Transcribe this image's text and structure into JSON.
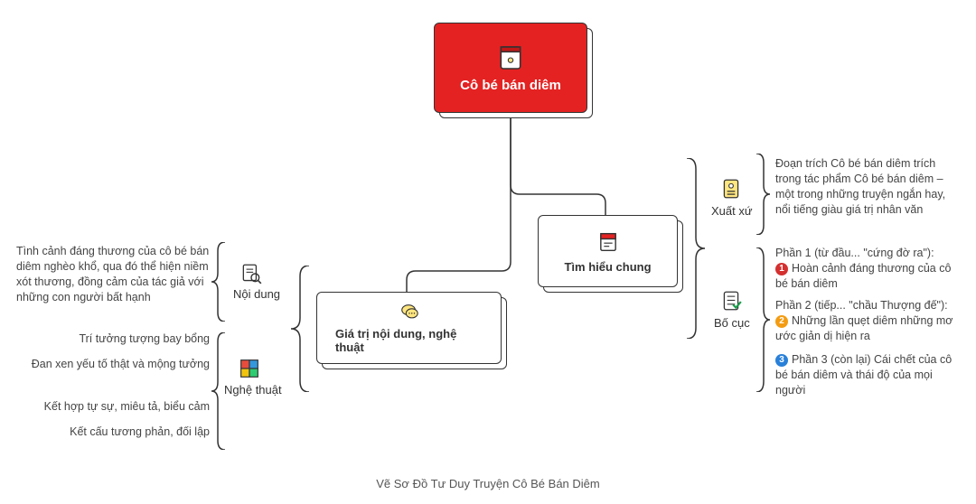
{
  "root": {
    "title": "Cô bé bán diêm"
  },
  "nodes": {
    "tim_hieu": "Tìm hiểu chung",
    "gia_tri": "Giá trị nội dung, nghệ thuật"
  },
  "subs": {
    "xuat_xu": "Xuất xứ",
    "bo_cuc": "Bố cục",
    "noi_dung": "Nội dung",
    "nghe_thuat": "Nghệ thuật"
  },
  "leaves": {
    "xuat_xu_text": "Đoạn trích Cô bé bán diêm trích trong tác phẩm Cô bé bán diêm – một trong những truyện ngắn hay, nổi tiếng giàu giá trị nhân văn",
    "bo_cuc_1a": "Phần 1 (từ đầu... \"cứng đờ ra\"):",
    "bo_cuc_1b": "Hoàn cảnh đáng thương của cô bé bán diêm",
    "bo_cuc_2a": "Phần 2 (tiếp... \"chầu Thượng đế\"):",
    "bo_cuc_2b": "Những lần quẹt diêm những mơ ước giản dị hiện ra",
    "bo_cuc_3a": "Phần 3 (còn lại) Cái chết của cô bé bán diêm và thái độ của mọi người",
    "noi_dung_text": "Tình cảnh đáng thương của cô bé bán diêm nghèo khổ, qua đó thể hiện niềm xót thương, đồng cảm của tác giả với những con người bất hạnh",
    "nt_1": "Trí tưởng tượng bay bổng",
    "nt_2": "Đan xen yếu tố thật và mộng tưởng",
    "nt_3": "Kết hợp tự sự, miêu tả, biểu cảm",
    "nt_4": "Kết cấu tương phản, đối lập"
  },
  "bullets": {
    "b1": "1",
    "b2": "2",
    "b3": "3"
  },
  "caption": "Vẽ Sơ Đồ Tư Duy Truyện Cô Bé Bán Diêm"
}
